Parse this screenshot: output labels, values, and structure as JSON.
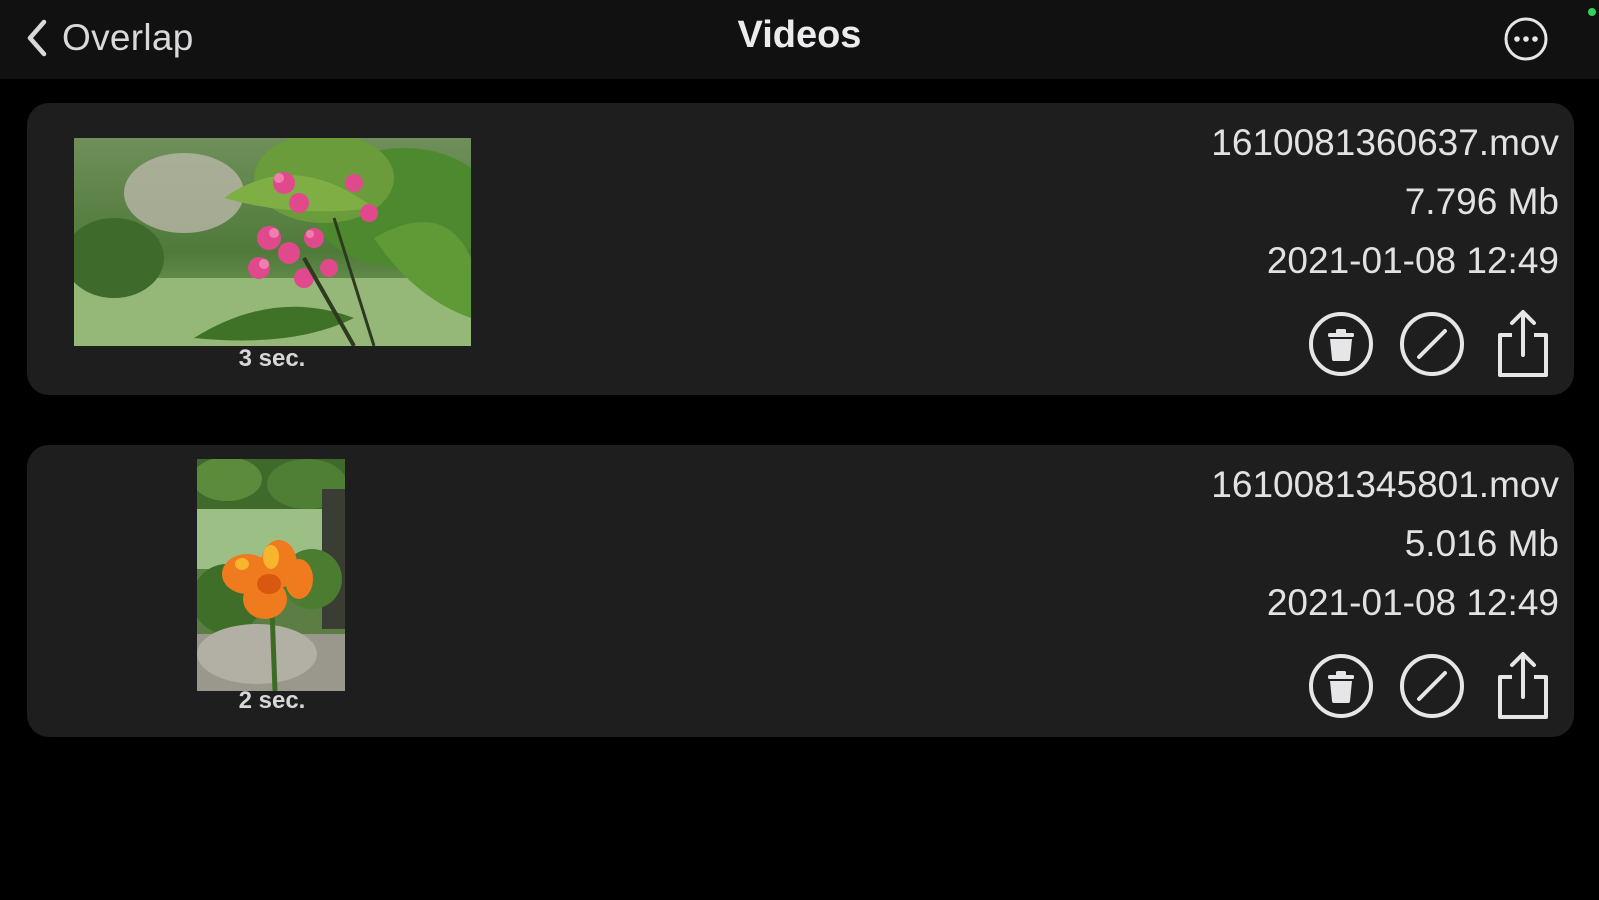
{
  "navbar": {
    "back_label": "Overlap",
    "title": "Videos",
    "more_icon": "ellipsis-circle-icon",
    "back_icon": "chevron-left-icon"
  },
  "videos": [
    {
      "thumbnail": "pink-flower-thumbnail",
      "duration": "3 sec.",
      "filename": "1610081360637.mov",
      "size": "7.796 Mb",
      "date": "2021-01-08 12:49"
    },
    {
      "thumbnail": "orange-flower-thumbnail",
      "duration": "2 sec.",
      "filename": "1610081345801.mov",
      "size": "5.016 Mb",
      "date": "2021-01-08 12:49"
    }
  ],
  "action_icons": [
    "trash-circle-icon",
    "edit-slash-circle-icon",
    "share-icon"
  ],
  "colors": {
    "background": "#000000",
    "navbar": "#111112",
    "card": "#1e1e1f",
    "text": "#e2e2e4",
    "status": "#30d158"
  }
}
